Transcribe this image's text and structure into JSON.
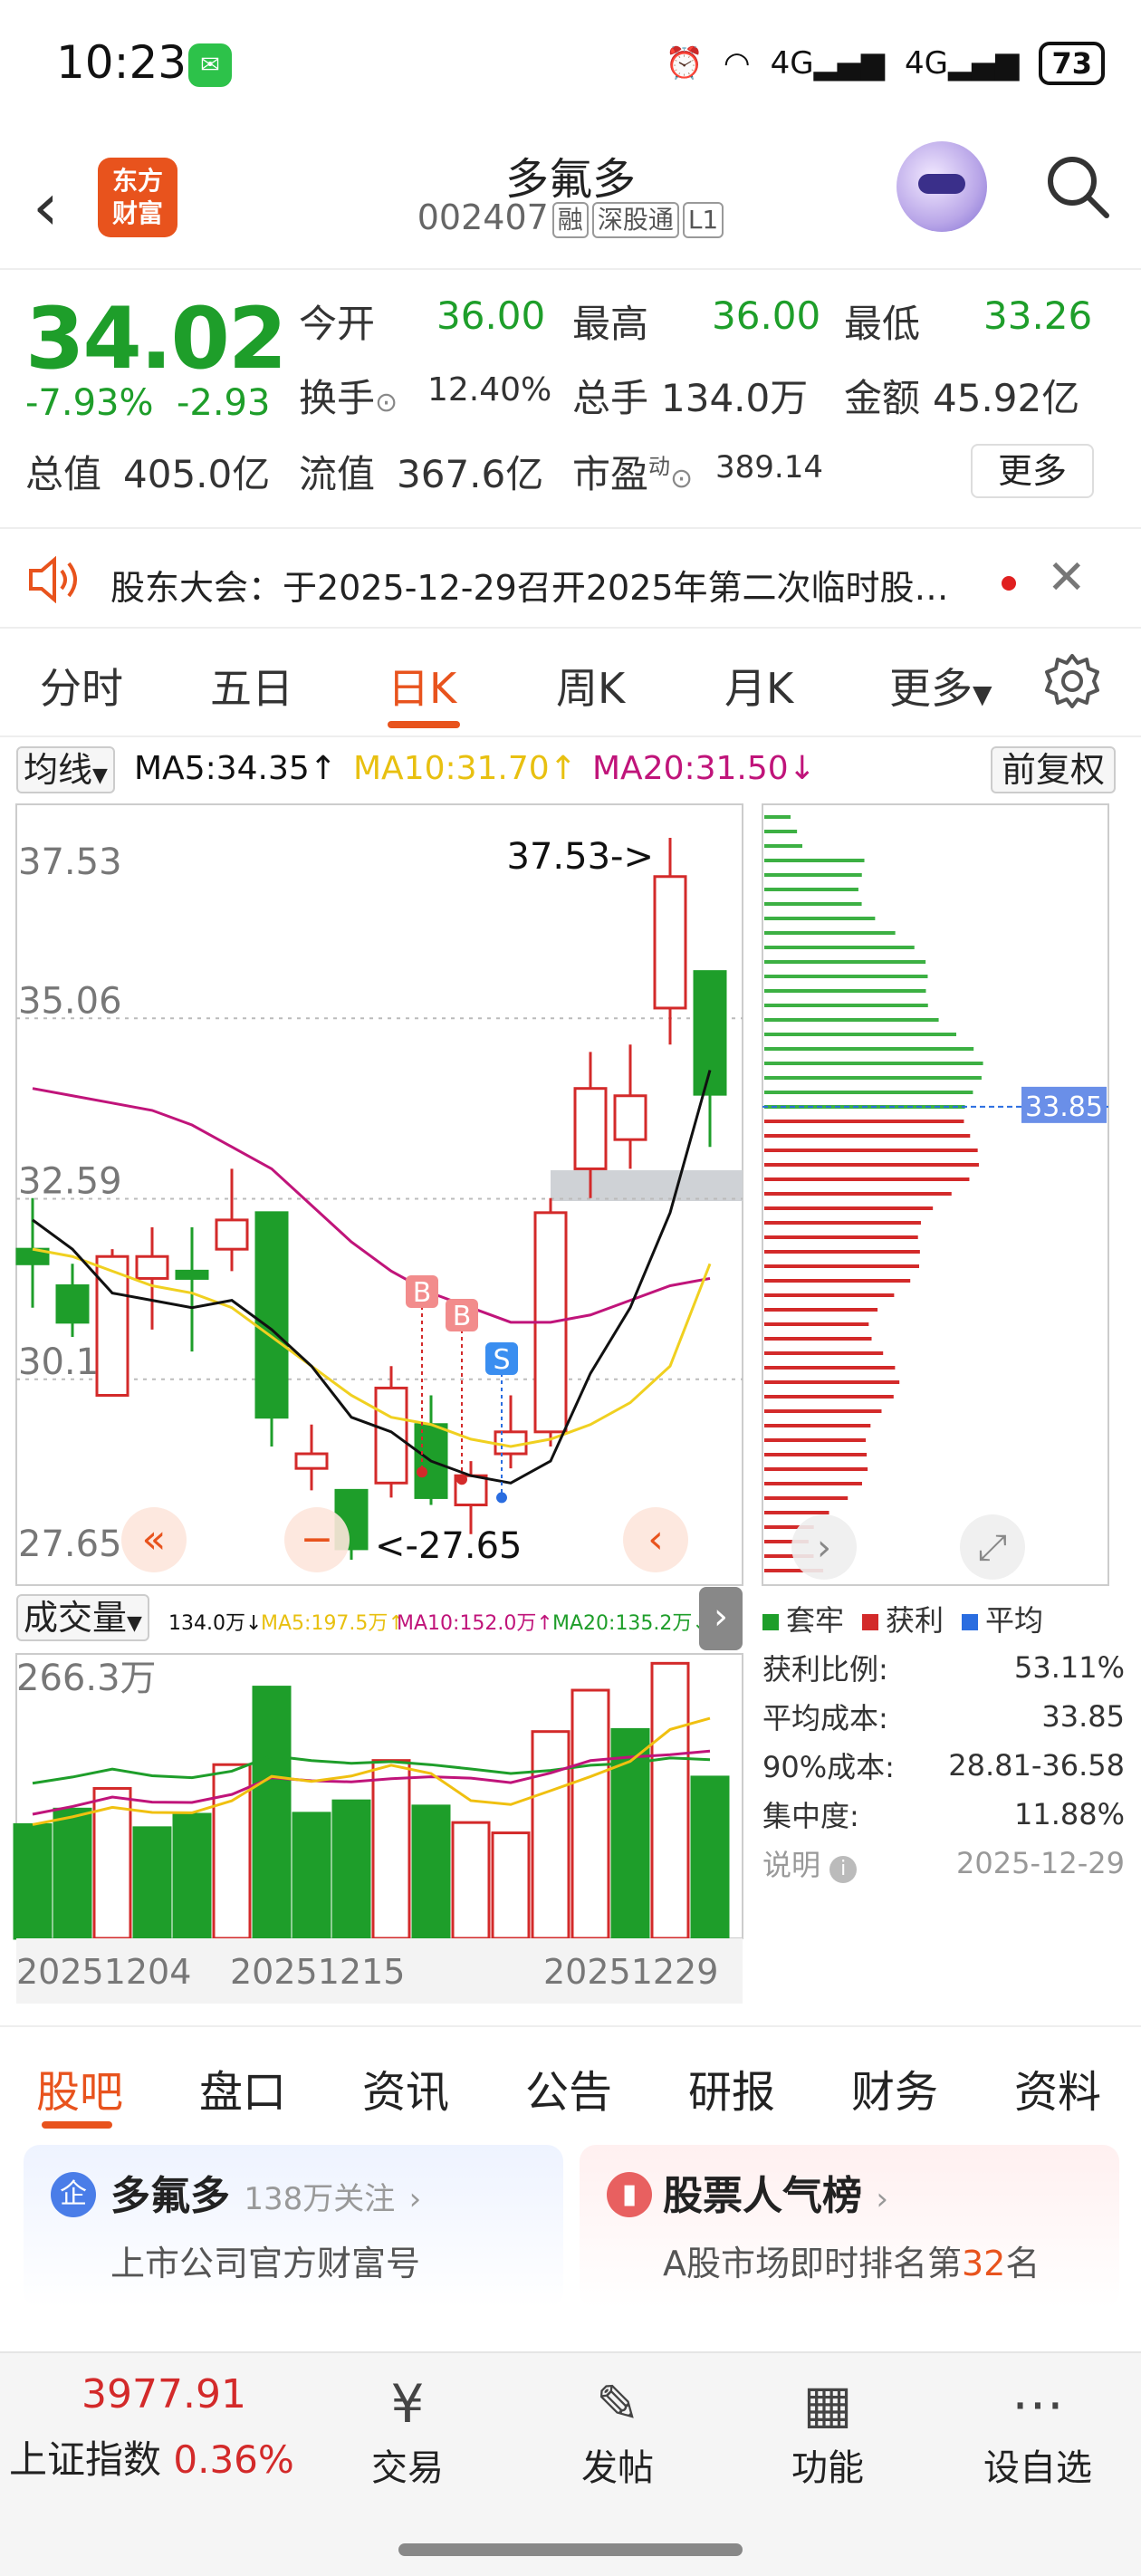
{
  "status_bar": {
    "time": "10:23",
    "battery": "73",
    "net1": "4G",
    "net2": "4G"
  },
  "header": {
    "logo_line1": "东方",
    "logo_line2": "财富",
    "name": "多氟多",
    "code": "002407",
    "tags": [
      "融",
      "深股通",
      "L1"
    ]
  },
  "quote": {
    "price": "34.02",
    "change_pct": "-7.93%",
    "change": "-2.93",
    "open_label": "今开",
    "open": "36.00",
    "high_label": "最高",
    "high": "36.00",
    "low_label": "最低",
    "low": "33.26",
    "turnover_label": "换手",
    "turnover": "12.40%",
    "volume_label": "总手",
    "volume": "134.0万",
    "amount_label": "金额",
    "amount": "45.92亿",
    "mktcap_label": "总值",
    "mktcap": "405.0亿",
    "float_label": "流值",
    "float": "367.6亿",
    "pe_label": "市盈",
    "pe_sup": "动",
    "pe": "389.14",
    "more": "更多"
  },
  "notice": {
    "text": "股东大会：于2025-12-29召开2025年第二次临时股…"
  },
  "kline_tabs": [
    "分时",
    "五日",
    "日K",
    "周K",
    "月K",
    "更多"
  ],
  "ma_bar": {
    "select": "均线",
    "ma5": "MA5:34.35",
    "ma10": "MA10:31.70",
    "ma20": "MA20:31.50",
    "adjust": "前复权"
  },
  "colors": {
    "up": "#d32a2a",
    "down": "#1e9e2a",
    "ma5": "#111111",
    "ma10": "#f0d020",
    "ma20": "#c0147a",
    "accent": "#e8531d"
  },
  "chart_data": [
    {
      "type": "candlestick",
      "y_ticks": [
        "37.53",
        "35.06",
        "32.59",
        "30.12",
        "27.65"
      ],
      "ylim": [
        27.65,
        37.53
      ],
      "high_marker": "37.53->",
      "low_marker": "<-27.65",
      "trade_markers": [
        "B",
        "B",
        "S"
      ],
      "candles": [
        {
          "o": 31.9,
          "h": 32.6,
          "l": 31.1,
          "c": 31.7
        },
        {
          "o": 31.4,
          "h": 31.7,
          "l": 30.7,
          "c": 30.9
        },
        {
          "o": 29.9,
          "h": 31.9,
          "l": 29.9,
          "c": 31.8
        },
        {
          "o": 31.5,
          "h": 32.2,
          "l": 30.8,
          "c": 31.8
        },
        {
          "o": 31.6,
          "h": 32.2,
          "l": 30.5,
          "c": 31.5
        },
        {
          "o": 31.9,
          "h": 33.0,
          "l": 31.6,
          "c": 32.3
        },
        {
          "o": 32.4,
          "h": 32.4,
          "l": 29.2,
          "c": 29.6
        },
        {
          "o": 28.9,
          "h": 29.5,
          "l": 28.6,
          "c": 29.1
        },
        {
          "o": 28.6,
          "h": 28.6,
          "l": 27.65,
          "c": 27.8
        },
        {
          "o": 28.7,
          "h": 30.3,
          "l": 28.5,
          "c": 30.0
        },
        {
          "o": 29.5,
          "h": 29.9,
          "l": 28.4,
          "c": 28.5
        },
        {
          "o": 28.4,
          "h": 29.0,
          "l": 28.0,
          "c": 28.8
        },
        {
          "o": 29.1,
          "h": 29.9,
          "l": 28.9,
          "c": 29.4
        },
        {
          "o": 29.4,
          "h": 32.6,
          "l": 29.2,
          "c": 32.4
        },
        {
          "o": 33.0,
          "h": 34.6,
          "l": 32.6,
          "c": 34.1
        },
        {
          "o": 33.4,
          "h": 34.7,
          "l": 33.0,
          "c": 34.0
        },
        {
          "o": 35.2,
          "h": 37.53,
          "l": 34.7,
          "c": 37.0
        },
        {
          "o": 35.7,
          "h": 35.7,
          "l": 33.3,
          "c": 34.02
        }
      ],
      "ma5": [
        32.3,
        31.9,
        31.3,
        31.2,
        31.1,
        31.2,
        30.8,
        30.3,
        29.6,
        29.4,
        29.0,
        28.8,
        28.7,
        29.0,
        30.2,
        31.1,
        32.4,
        34.35
      ],
      "ma10": [
        31.9,
        31.8,
        31.6,
        31.4,
        31.3,
        31.1,
        30.7,
        30.3,
        29.9,
        29.6,
        29.5,
        29.3,
        29.2,
        29.3,
        29.5,
        29.8,
        30.3,
        31.7
      ],
      "ma20": [
        34.1,
        34.0,
        33.9,
        33.8,
        33.6,
        33.3,
        33.0,
        32.5,
        32.0,
        31.6,
        31.3,
        31.1,
        30.9,
        30.9,
        31.0,
        31.2,
        31.4,
        31.5
      ],
      "chip_avg_cost": "33.85"
    },
    {
      "type": "bar",
      "title": "成交量",
      "legend": [
        "134.0万",
        "MA5:197.5万",
        "MA10:152.0万",
        "MA20:135.2万"
      ],
      "y_tick": "266.3万",
      "x_ticks": [
        "20251204",
        "20251215",
        "20251229"
      ],
      "volumes": [
        {
          "v": 110,
          "up": false
        },
        {
          "v": 125,
          "up": false
        },
        {
          "v": 145,
          "up": true
        },
        {
          "v": 107,
          "up": false
        },
        {
          "v": 120,
          "up": false
        },
        {
          "v": 168,
          "up": true
        },
        {
          "v": 243,
          "up": false
        },
        {
          "v": 121,
          "up": false
        },
        {
          "v": 133,
          "up": false
        },
        {
          "v": 172,
          "up": true
        },
        {
          "v": 128,
          "up": false
        },
        {
          "v": 112,
          "up": true
        },
        {
          "v": 102,
          "up": true
        },
        {
          "v": 200,
          "up": true
        },
        {
          "v": 240,
          "up": true
        },
        {
          "v": 202,
          "up": false
        },
        {
          "v": 266,
          "up": true
        },
        {
          "v": 156,
          "up": false
        }
      ]
    }
  ],
  "chips": {
    "legend": [
      "套牢",
      "获利",
      "平均"
    ],
    "profit_ratio_label": "获利比例:",
    "profit_ratio": "53.11%",
    "avg_cost_label": "平均成本:",
    "avg_cost": "33.85",
    "cost90_label": "90%成本:",
    "cost90": "28.81-36.58",
    "concentration_label": "集中度:",
    "concentration": "11.88%",
    "note_label": "说明",
    "note_date": "2025-12-29"
  },
  "bottom_tabs": [
    "股吧",
    "盘口",
    "资讯",
    "公告",
    "研报",
    "财务",
    "资料"
  ],
  "cards": [
    {
      "title": "多氟多",
      "sub": "138万关注",
      "desc": "上市公司官方财富号"
    },
    {
      "title": "股票人气榜",
      "desc_pre": "A股市场即时排名第",
      "rank": "32",
      "desc_post": "名"
    }
  ],
  "footer": {
    "index_value": "3977.91",
    "index_name": "上证指数",
    "index_change": "0.36%",
    "items": [
      "交易",
      "发帖",
      "功能",
      "设自选"
    ]
  }
}
